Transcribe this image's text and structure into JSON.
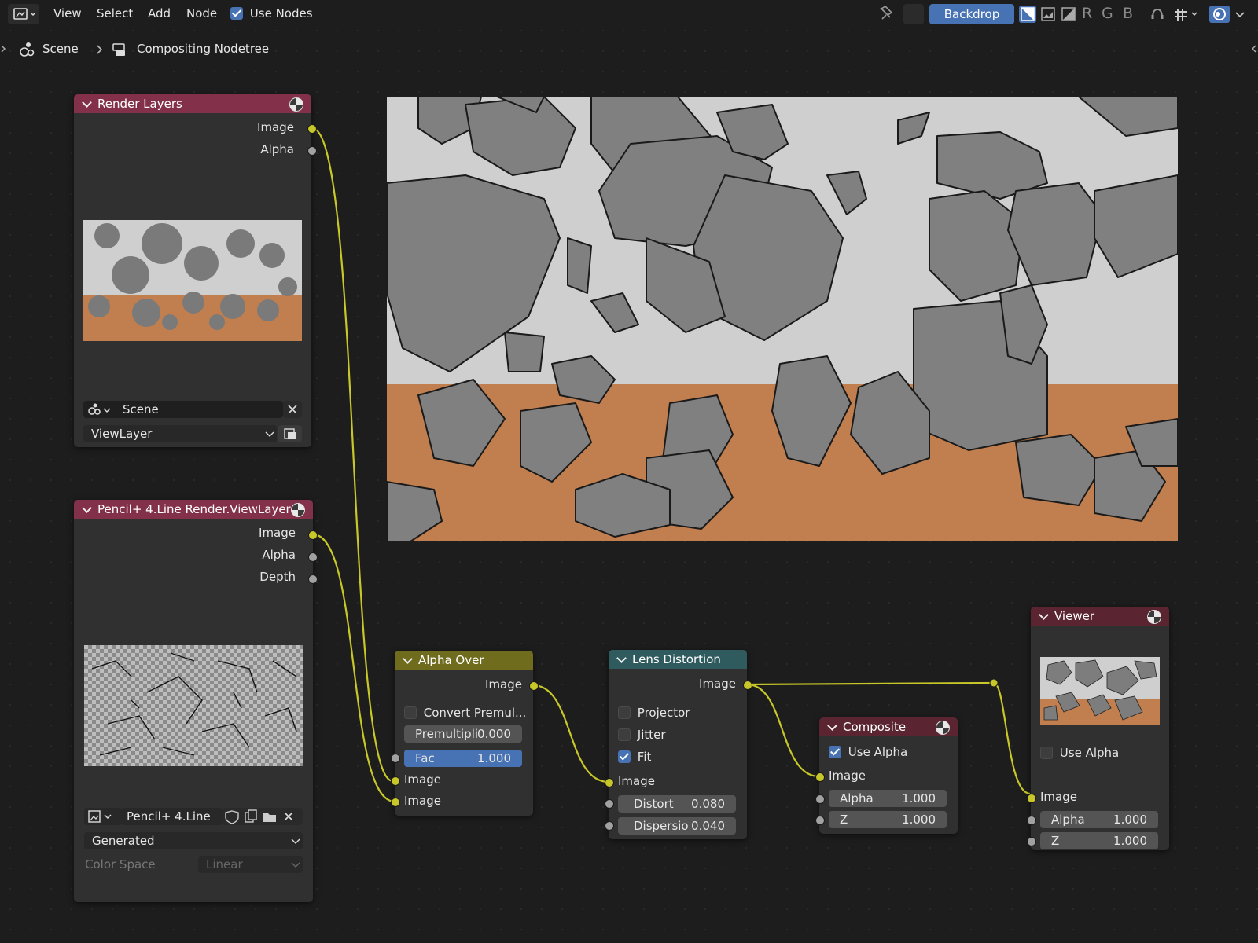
{
  "header": {
    "menus": [
      "View",
      "Select",
      "Add",
      "Node"
    ],
    "use_nodes_label": "Use Nodes",
    "use_nodes_checked": true,
    "backdrop_label": "Backdrop",
    "channels": [
      "R",
      "G",
      "B"
    ]
  },
  "breadcrumb": {
    "scene": "Scene",
    "nodetree": "Compositing Nodetree"
  },
  "nodes": {
    "render_layers": {
      "title": "Render Layers",
      "outputs": [
        "Image",
        "Alpha"
      ],
      "scene_value": "Scene",
      "view_layer_value": "ViewLayer"
    },
    "pencil": {
      "title": "Pencil+ 4.Line Render.ViewLayer",
      "outputs": [
        "Image",
        "Alpha",
        "Depth"
      ],
      "image_name": "Pencil+ 4.Line ...",
      "source_value": "Generated",
      "color_space_label": "Color Space",
      "color_space_value": "Linear"
    },
    "alpha_over": {
      "title": "Alpha Over",
      "output": "Image",
      "convert_label": "Convert Premul...",
      "convert_checked": false,
      "premul_label": "Premultipli",
      "premul_value": "0.000",
      "fac_label": "Fac",
      "fac_value": "1.000",
      "input1": "Image",
      "input2": "Image"
    },
    "lens_distortion": {
      "title": "Lens Distortion",
      "output": "Image",
      "projector_label": "Projector",
      "projector_checked": false,
      "jitter_label": "Jitter",
      "jitter_checked": false,
      "fit_label": "Fit",
      "fit_checked": true,
      "input": "Image",
      "distort_label": "Distort",
      "distort_value": "0.080",
      "dispersion_label": "Dispersio",
      "dispersion_value": "0.040"
    },
    "composite": {
      "title": "Composite",
      "use_alpha_label": "Use Alpha",
      "use_alpha_checked": true,
      "input": "Image",
      "alpha_label": "Alpha",
      "alpha_value": "1.000",
      "z_label": "Z",
      "z_value": "1.000"
    },
    "viewer": {
      "title": "Viewer",
      "use_alpha_label": "Use Alpha",
      "use_alpha_checked": false,
      "input": "Image",
      "alpha_label": "Alpha",
      "alpha_value": "1.000",
      "z_label": "Z",
      "z_value": "1.000"
    }
  },
  "colors": {
    "input_header": "#83314a",
    "mix_header": "#6f6c1e",
    "distort_header": "#2f5a5e",
    "output_header": "#5a2530",
    "socket_color": "#c7c729",
    "socket_value": "#a1a1a1",
    "accent": "#4772b3",
    "link": "#c7c729",
    "backdrop_orange": "#c17e4f",
    "backdrop_sky": "#cfcfcf"
  }
}
